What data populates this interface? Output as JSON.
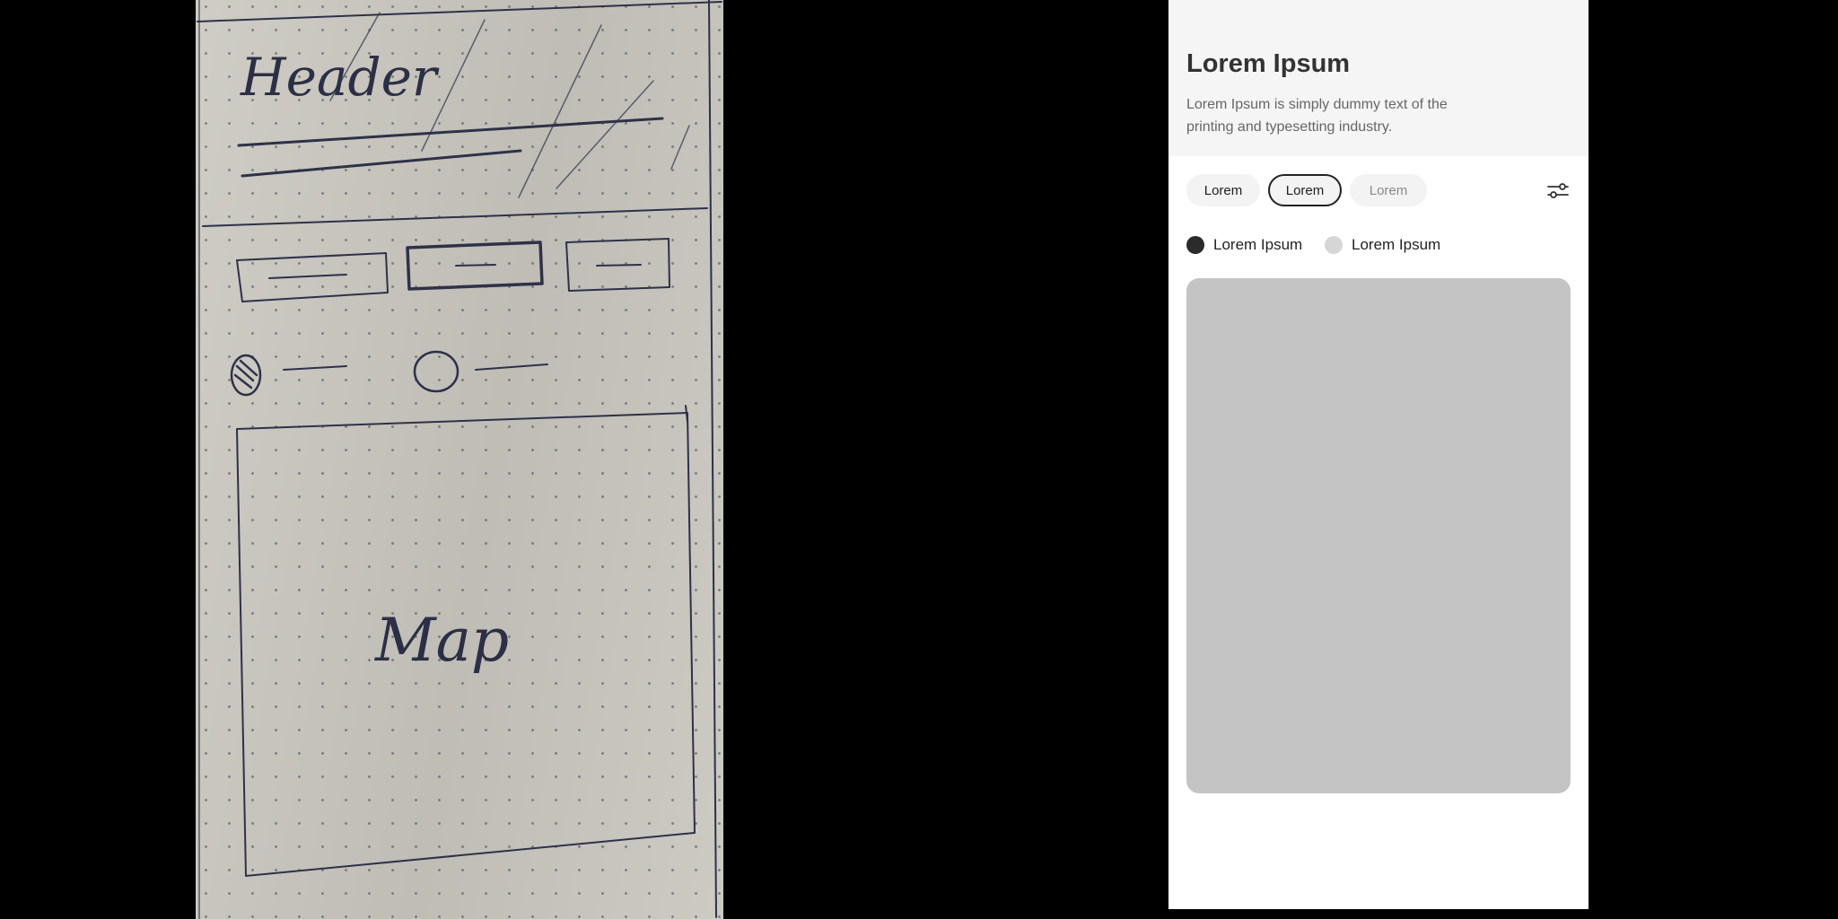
{
  "sketch": {
    "header_label": "Header",
    "map_label": "Map"
  },
  "screen": {
    "header": {
      "title": "Lorem Ipsum",
      "description": "Lorem Ipsum is simply dummy text of the printing and typesetting industry."
    },
    "chips": [
      {
        "label": "Lorem",
        "state": "default"
      },
      {
        "label": "Lorem",
        "state": "selected"
      },
      {
        "label": "Lorem",
        "state": "muted"
      }
    ],
    "filter_icon": "sliders-icon",
    "legend": [
      {
        "label": "Lorem Ipsum",
        "color": "#2b2b2b"
      },
      {
        "label": "Lorem Ipsum",
        "color": "#d6d6d6"
      }
    ],
    "map_placeholder_color": "#c4c4c4"
  }
}
